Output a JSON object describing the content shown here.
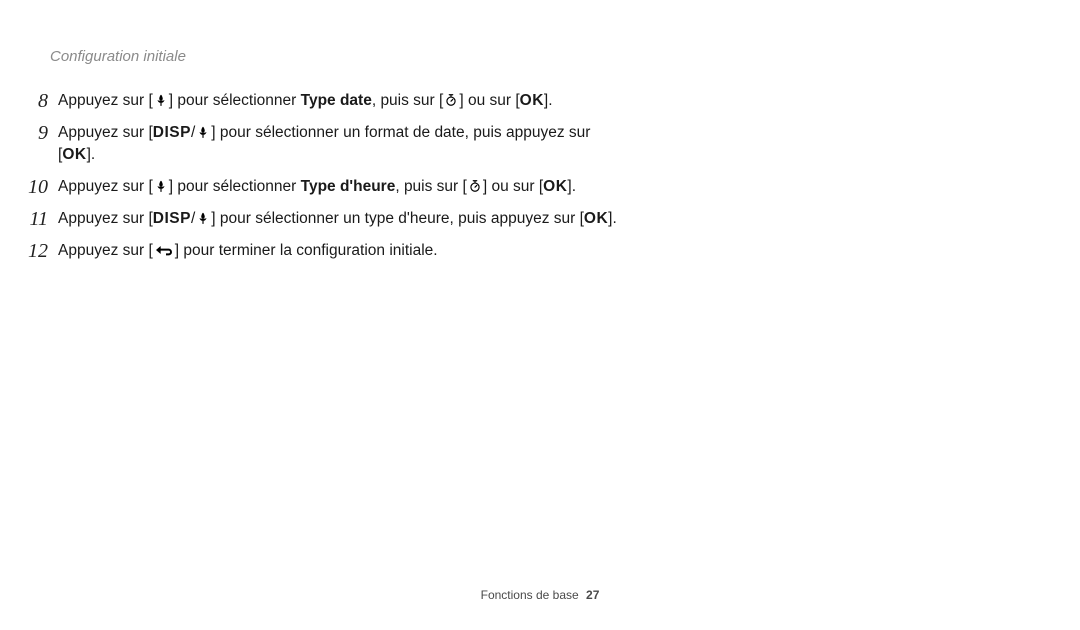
{
  "header": {
    "title": "Configuration initiale"
  },
  "icons": {
    "macro": "macro-icon",
    "timer": "timer-icon",
    "ok": "OK",
    "disp": "DISP",
    "back": "back-icon"
  },
  "steps": [
    {
      "num": "8",
      "parts": [
        {
          "t": "text",
          "v": "Appuyez sur "
        },
        {
          "t": "bracket",
          "v": [
            "macro"
          ]
        },
        {
          "t": "text",
          "v": " pour sélectionner "
        },
        {
          "t": "bold",
          "v": "Type date"
        },
        {
          "t": "text",
          "v": ", puis sur "
        },
        {
          "t": "bracket",
          "v": [
            "timer"
          ]
        },
        {
          "t": "text",
          "v": " ou sur "
        },
        {
          "t": "bracket",
          "v": [
            "ok"
          ]
        },
        {
          "t": "text",
          "v": "."
        }
      ]
    },
    {
      "num": "9",
      "parts": [
        {
          "t": "text",
          "v": "Appuyez sur "
        },
        {
          "t": "bracket",
          "v": [
            "disp",
            "/",
            "macro"
          ]
        },
        {
          "t": "text",
          "v": " pour sélectionner un format de date, puis appuyez sur "
        },
        {
          "t": "bracket",
          "v": [
            "ok"
          ]
        },
        {
          "t": "text",
          "v": "."
        }
      ]
    },
    {
      "num": "10",
      "parts": [
        {
          "t": "text",
          "v": "Appuyez sur "
        },
        {
          "t": "bracket",
          "v": [
            "macro"
          ]
        },
        {
          "t": "text",
          "v": " pour sélectionner "
        },
        {
          "t": "bold",
          "v": "Type d'heure"
        },
        {
          "t": "text",
          "v": ", puis sur "
        },
        {
          "t": "bracket",
          "v": [
            "timer"
          ]
        },
        {
          "t": "text",
          "v": " ou sur "
        },
        {
          "t": "bracket",
          "v": [
            "ok"
          ]
        },
        {
          "t": "text",
          "v": "."
        }
      ]
    },
    {
      "num": "11",
      "parts": [
        {
          "t": "text",
          "v": "Appuyez sur "
        },
        {
          "t": "bracket",
          "v": [
            "disp",
            "/",
            "macro"
          ]
        },
        {
          "t": "text",
          "v": " pour sélectionner un type d'heure, puis appuyez sur "
        },
        {
          "t": "bracket",
          "v": [
            "ok"
          ]
        },
        {
          "t": "text",
          "v": "."
        }
      ]
    },
    {
      "num": "12",
      "parts": [
        {
          "t": "text",
          "v": "Appuyez sur "
        },
        {
          "t": "bracket",
          "v": [
            "back"
          ]
        },
        {
          "t": "text",
          "v": " pour terminer la configuration initiale."
        }
      ]
    }
  ],
  "footer": {
    "section": "Fonctions de base",
    "page": "27"
  }
}
